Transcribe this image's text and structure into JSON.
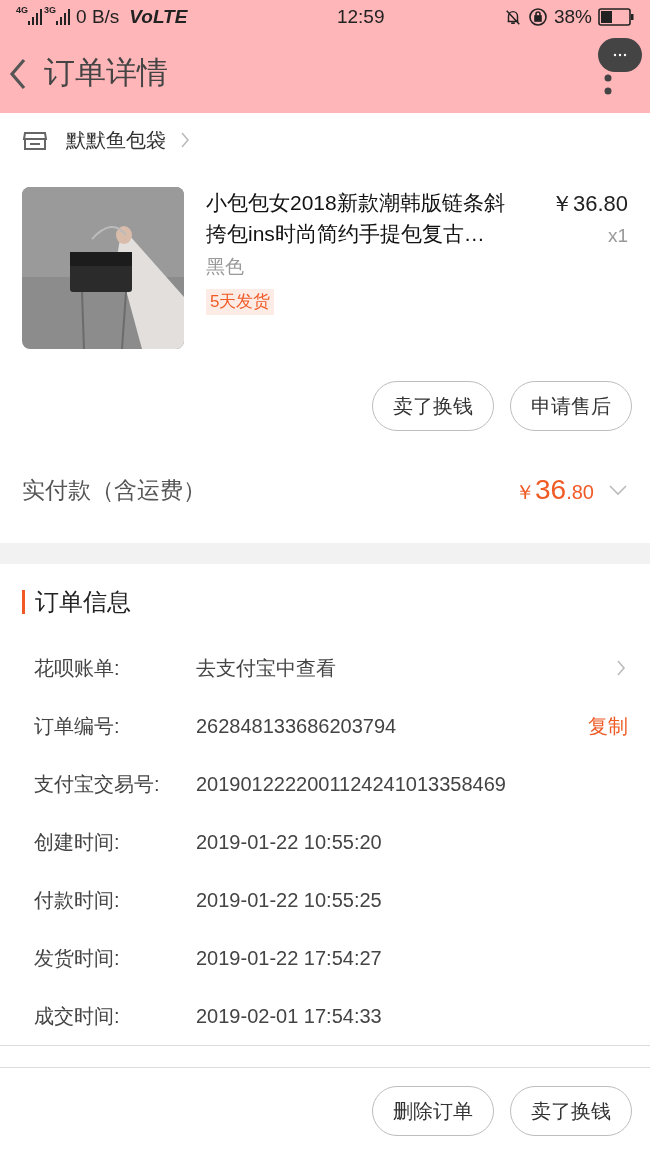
{
  "status_bar": {
    "net1": "4G",
    "net2": "3G",
    "speed": "0 B/s",
    "volte": "VoLTE",
    "time": "12:59",
    "battery": "38%"
  },
  "header": {
    "title": "订单详情"
  },
  "shop": {
    "name": "默默鱼包袋"
  },
  "product": {
    "title": "小包包女2018新款潮韩版链条斜挎包ins时尚简约手提包复古…",
    "price": "￥36.80",
    "quantity": "x1",
    "variant": "黑色",
    "tag": "5天发货"
  },
  "item_buttons": [
    "卖了换钱",
    "申请售后"
  ],
  "payment": {
    "label": "实付款（含运费）",
    "currency": "￥",
    "amount_major": "36",
    "amount_minor": ".80"
  },
  "order_info": {
    "title": "订单信息",
    "rows": [
      {
        "label": "花呗账单:",
        "value": "去支付宝中查看",
        "kind": "link"
      },
      {
        "label": "订单编号:",
        "value": "262848133686203794",
        "kind": "copy",
        "action": "复制"
      },
      {
        "label": "支付宝交易号:",
        "value": "2019012222001124241013358469",
        "kind": "plain"
      },
      {
        "label": "创建时间:",
        "value": "2019-01-22 10:55:20",
        "kind": "plain"
      },
      {
        "label": "付款时间:",
        "value": "2019-01-22 10:55:25",
        "kind": "plain"
      },
      {
        "label": "发货时间:",
        "value": "2019-01-22 17:54:27",
        "kind": "plain"
      },
      {
        "label": "成交时间:",
        "value": "2019-02-01 17:54:33",
        "kind": "plain"
      }
    ]
  },
  "bottom_buttons": [
    "删除订单",
    "卖了换钱"
  ]
}
